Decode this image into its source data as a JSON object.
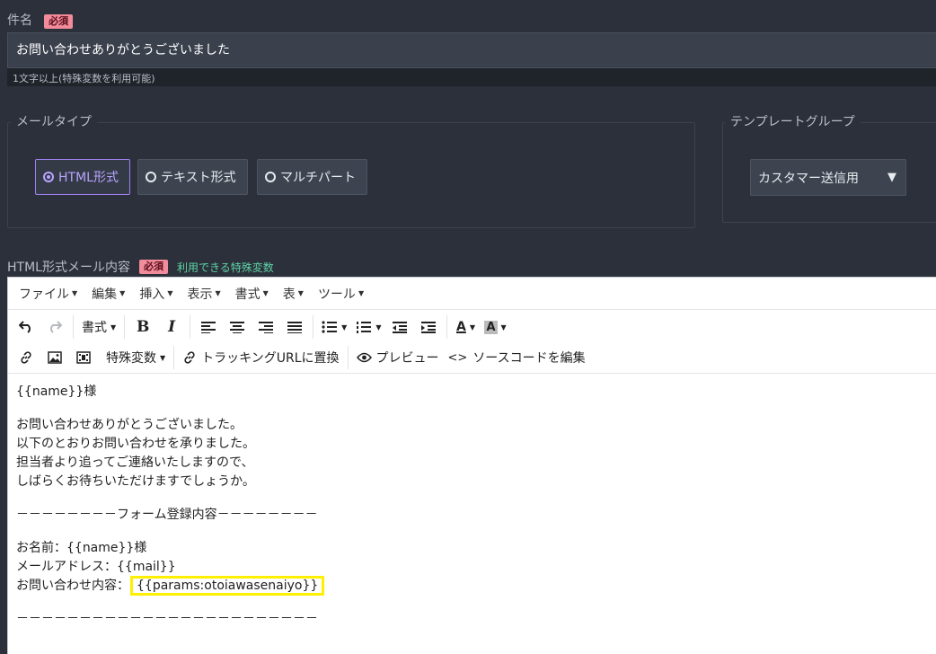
{
  "subject": {
    "label": "件名",
    "required_badge": "必須",
    "value": "お問い合わせありがとうございました",
    "hint": "1文字以上(特殊変数を利用可能)"
  },
  "mail_type": {
    "legend": "メールタイプ",
    "options": [
      "HTML形式",
      "テキスト形式",
      "マルチパート"
    ],
    "selected": "HTML形式"
  },
  "template_group": {
    "legend": "テンプレートグループ",
    "selected": "カスタマー送信用"
  },
  "html_content": {
    "label": "HTML形式メール内容",
    "required_badge": "必須",
    "vars_link": "利用できる特殊変数"
  },
  "editor": {
    "menu": [
      "ファイル",
      "編集",
      "挿入",
      "表示",
      "書式",
      "表",
      "ツール"
    ],
    "toolbar": {
      "format_label": "書式",
      "special_vars_label": "特殊変数",
      "tracking_label": "トラッキングURLに置換",
      "preview_label": "プレビュー",
      "source_label": "ソースコードを編集"
    },
    "lines": [
      "{{name}}様",
      "",
      "お問い合わせありがとうございました。",
      "以下のとおりお問い合わせを承りました。",
      "担当者より追ってご連絡いたしますので、",
      "しばらくお待ちいただけますでしょうか。",
      "",
      "－－－－－－－－フォーム登録内容－－－－－－－－",
      "",
      "お名前：{{name}}様",
      "メールアドレス：{{mail}}",
      "お問い合わせ内容：",
      "",
      "－－－－－－－－－－－－－－－－－－－－－－－－"
    ],
    "highlighted_var": "{{params:otoiawasenaiyo}}"
  },
  "colors": {
    "background": "#2b303a",
    "required_badge": "#f28b9a",
    "active_radio": "#a081f0",
    "vars_link": "#5fd3a5",
    "highlight": "#ffef00"
  }
}
